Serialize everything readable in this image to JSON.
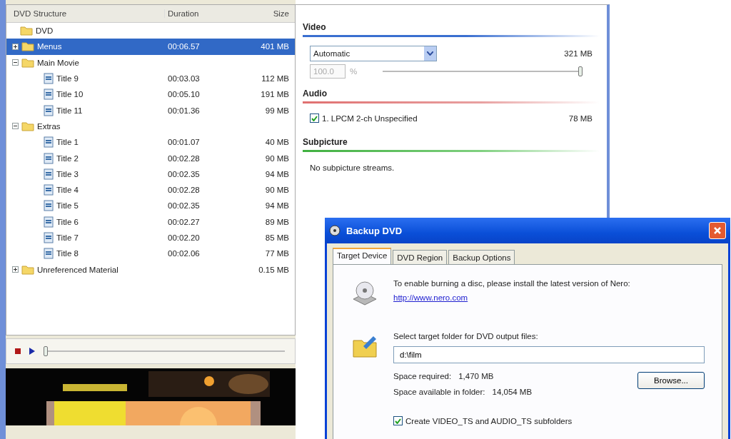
{
  "tree": {
    "columns": [
      "DVD Structure",
      "Duration",
      "Size"
    ],
    "items": [
      {
        "label": "DVD",
        "kind": "folder",
        "selected": false,
        "children": [
          {
            "label": "Menus",
            "kind": "folder",
            "expanded": false,
            "selected": true,
            "duration": "00:06.57",
            "size": "401 MB"
          },
          {
            "label": "Main Movie",
            "kind": "folder",
            "expanded": true,
            "selected": false,
            "children": [
              {
                "label": "Title 9",
                "kind": "title",
                "selected": false,
                "duration": "00:03.03",
                "size": "112 MB"
              },
              {
                "label": "Title 10",
                "kind": "title",
                "selected": false,
                "duration": "00:05.10",
                "size": "191 MB"
              },
              {
                "label": "Title 11",
                "kind": "title",
                "selected": false,
                "duration": "00:01.36",
                "size": "99 MB"
              }
            ]
          },
          {
            "label": "Extras",
            "kind": "folder",
            "expanded": true,
            "selected": false,
            "children": [
              {
                "label": "Title 1",
                "kind": "title",
                "selected": false,
                "duration": "00:01.07",
                "size": "40 MB"
              },
              {
                "label": "Title 2",
                "kind": "title",
                "selected": false,
                "duration": "00:02.28",
                "size": "90 MB"
              },
              {
                "label": "Title 3",
                "kind": "title",
                "selected": false,
                "duration": "00:02.35",
                "size": "94 MB"
              },
              {
                "label": "Title 4",
                "kind": "title",
                "selected": false,
                "duration": "00:02.28",
                "size": "90 MB"
              },
              {
                "label": "Title 5",
                "kind": "title",
                "selected": false,
                "duration": "00:02.35",
                "size": "94 MB"
              },
              {
                "label": "Title 6",
                "kind": "title",
                "selected": false,
                "duration": "00:02.27",
                "size": "89 MB"
              },
              {
                "label": "Title 7",
                "kind": "title",
                "selected": false,
                "duration": "00:02.20",
                "size": "85 MB"
              },
              {
                "label": "Title 8",
                "kind": "title",
                "selected": false,
                "duration": "00:02.06",
                "size": "77 MB"
              }
            ]
          },
          {
            "label": "Unreferenced Material",
            "kind": "folder",
            "expanded": false,
            "selected": false,
            "size": "0.15 MB"
          }
        ]
      }
    ]
  },
  "player": {
    "level": 0
  },
  "compression": {
    "video": {
      "heading": "Video",
      "mode": "Automatic",
      "size": "321 MB",
      "percent": "100.0",
      "percent_unit": "%",
      "percent_disabled": true,
      "level": 1
    },
    "audio": {
      "heading": "Audio",
      "streams": [
        {
          "label": "1. LPCM 2-ch Unspecified",
          "size": "78 MB",
          "checked": true
        }
      ]
    },
    "subpicture": {
      "heading": "Subpicture",
      "message": "No subpicture streams."
    }
  },
  "dialog": {
    "title": "Backup DVD",
    "tabs": [
      {
        "label": "Target Device",
        "selected": true
      },
      {
        "label": "DVD Region",
        "selected": false
      },
      {
        "label": "Backup Options",
        "selected": false
      }
    ],
    "burn_note": "To enable burning a disc, please install the latest version of Nero:",
    "link": "http://www.nero.com",
    "folder_label": "Select target folder for DVD output files:",
    "folder_value": "d:\\film",
    "space_required_label": "Space required:",
    "space_required": "1,470 MB",
    "space_available_label": "Space available in folder:",
    "space_available": "14,054 MB",
    "browse": "Browse...",
    "subfolders": {
      "label": "Create VIDEO_TS and AUDIO_TS subfolders",
      "checked": true
    }
  }
}
